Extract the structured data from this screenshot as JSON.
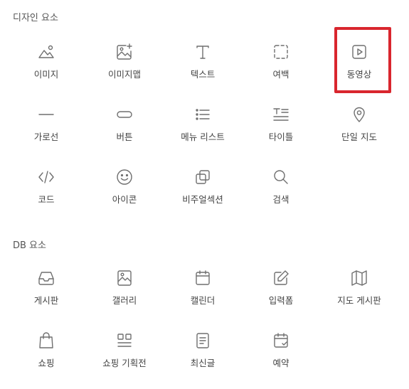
{
  "design_section": {
    "title": "디자인 요소",
    "items": [
      {
        "label": "이미지",
        "icon": "image-icon"
      },
      {
        "label": "이미지맵",
        "icon": "image-map-icon"
      },
      {
        "label": "텍스트",
        "icon": "text-icon"
      },
      {
        "label": "여백",
        "icon": "spacing-icon"
      },
      {
        "label": "동영상",
        "icon": "video-icon"
      },
      {
        "label": "가로선",
        "icon": "horizontal-line-icon"
      },
      {
        "label": "버튼",
        "icon": "button-icon"
      },
      {
        "label": "메뉴 리스트",
        "icon": "menu-list-icon"
      },
      {
        "label": "타이틀",
        "icon": "title-icon"
      },
      {
        "label": "단일 지도",
        "icon": "map-pin-icon"
      },
      {
        "label": "코드",
        "icon": "code-icon"
      },
      {
        "label": "아이콘",
        "icon": "smiley-icon"
      },
      {
        "label": "비주얼섹션",
        "icon": "visual-section-icon"
      },
      {
        "label": "검색",
        "icon": "search-icon"
      }
    ]
  },
  "db_section": {
    "title": "DB 요소",
    "items": [
      {
        "label": "게시판",
        "icon": "inbox-icon"
      },
      {
        "label": "갤러리",
        "icon": "gallery-icon"
      },
      {
        "label": "캘린더",
        "icon": "calendar-icon"
      },
      {
        "label": "입력폼",
        "icon": "edit-form-icon"
      },
      {
        "label": "지도 게시판",
        "icon": "map-board-icon"
      },
      {
        "label": "쇼핑",
        "icon": "shopping-bag-icon"
      },
      {
        "label": "쇼핑 기획전",
        "icon": "shopping-exhibition-icon"
      },
      {
        "label": "최신글",
        "icon": "document-icon"
      },
      {
        "label": "예약",
        "icon": "calendar-check-icon"
      }
    ]
  },
  "highlight": {
    "target": "동영상",
    "color": "#d9262e"
  }
}
